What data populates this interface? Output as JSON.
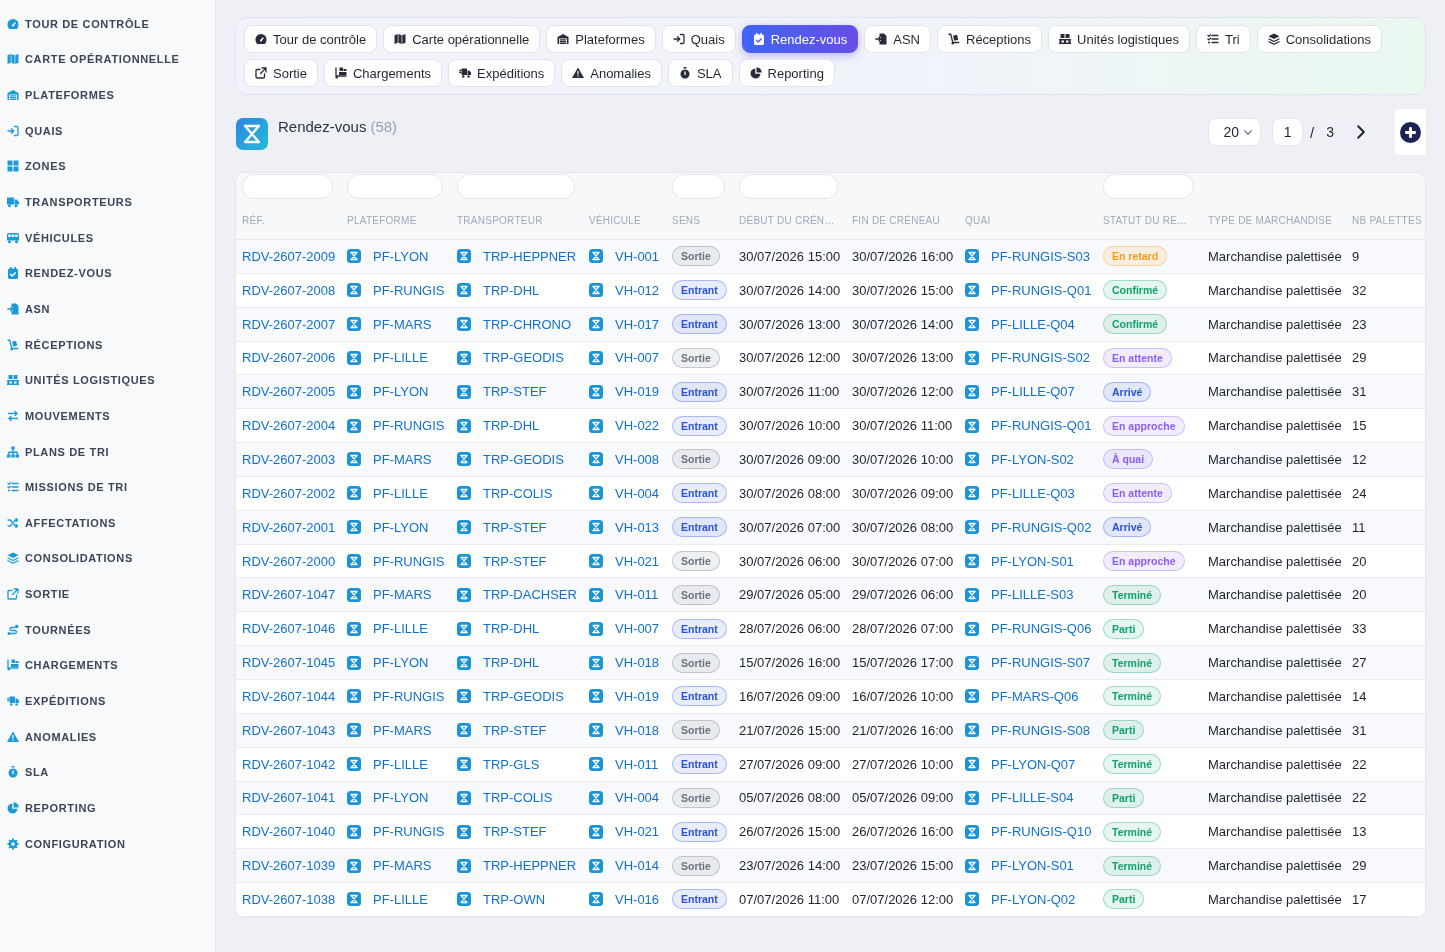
{
  "sidebar": {
    "items": [
      {
        "label": "TOUR DE CONTRÔLE"
      },
      {
        "label": "CARTE OPÉRATIONNELLE"
      },
      {
        "label": "PLATEFORMES"
      },
      {
        "label": "QUAIS"
      },
      {
        "label": "ZONES"
      },
      {
        "label": "TRANSPORTEURS"
      },
      {
        "label": "VÉHICULES"
      },
      {
        "label": "RENDEZ-VOUS"
      },
      {
        "label": "ASN"
      },
      {
        "label": "RÉCEPTIONS"
      },
      {
        "label": "UNITÉS LOGISTIQUES"
      },
      {
        "label": "MOUVEMENTS"
      },
      {
        "label": "PLANS DE TRI"
      },
      {
        "label": "MISSIONS DE TRI"
      },
      {
        "label": "AFFECTATIONS"
      },
      {
        "label": "CONSOLIDATIONS"
      },
      {
        "label": "SORTIE"
      },
      {
        "label": "TOURNÉES"
      },
      {
        "label": "CHARGEMENTS"
      },
      {
        "label": "EXPÉDITIONS"
      },
      {
        "label": "ANOMALIES"
      },
      {
        "label": "SLA"
      },
      {
        "label": "REPORTING"
      },
      {
        "label": "CONFIGURATION"
      }
    ]
  },
  "tabs": [
    {
      "label": "Tour de contrôle",
      "selected": false
    },
    {
      "label": "Carte opérationnelle",
      "selected": false
    },
    {
      "label": "Plateformes",
      "selected": false
    },
    {
      "label": "Quais",
      "selected": false
    },
    {
      "label": "Rendez-vous",
      "selected": true
    },
    {
      "label": "ASN",
      "selected": false
    },
    {
      "label": "Réceptions",
      "selected": false
    },
    {
      "label": "Unités logistiques",
      "selected": false
    },
    {
      "label": "Tri",
      "selected": false
    },
    {
      "label": "Consolidations",
      "selected": false
    },
    {
      "label": "Sortie",
      "selected": false
    },
    {
      "label": "Chargements",
      "selected": false
    },
    {
      "label": "Expéditions",
      "selected": false
    },
    {
      "label": "Anomalies",
      "selected": false
    },
    {
      "label": "SLA",
      "selected": false
    },
    {
      "label": "Reporting",
      "selected": false
    }
  ],
  "header": {
    "title": "Rendez-vous",
    "count": "(58)",
    "page_size": "20",
    "page": "1",
    "separator": "/",
    "total_pages": "3"
  },
  "table": {
    "columns": [
      {
        "label": "RÉF.",
        "filter": true
      },
      {
        "label": "PLATEFORME",
        "filter": true
      },
      {
        "label": "TRANSPORTEUR",
        "filter": true
      },
      {
        "label": "VÉHICULE",
        "filter": false
      },
      {
        "label": "SENS",
        "filter": true
      },
      {
        "label": "DÉBUT DU CRÉN…",
        "filter": true
      },
      {
        "label": "FIN DE CRÉNEAU",
        "filter": false
      },
      {
        "label": "QUAI",
        "filter": false
      },
      {
        "label": "STATUT DU RE…",
        "filter": true
      },
      {
        "label": "TYPE DE MARCHANDISE",
        "filter": false
      },
      {
        "label": "NB PALETTES",
        "filter": false
      }
    ],
    "rows": [
      {
        "ref": "RDV-2607-2009",
        "platform": "PF-LYON",
        "carrier": "TRP-HEPPNER",
        "vehicle": "VH-001",
        "direction": {
          "label": "Sortie",
          "color": "#6b7280"
        },
        "start": "30/07/2026 15:00",
        "end": "30/07/2026 16:00",
        "dock": "PF-RUNGIS-S03",
        "status": {
          "label": "En retard",
          "color": "#f59e0b"
        },
        "goods": "Marchandise palettisée",
        "pallets": "9"
      },
      {
        "ref": "RDV-2607-2008",
        "platform": "PF-RUNGIS",
        "carrier": "TRP-DHL",
        "vehicle": "VH-012",
        "direction": {
          "label": "Entrant",
          "color": "#2952d9"
        },
        "start": "30/07/2026 14:00",
        "end": "30/07/2026 15:00",
        "dock": "PF-RUNGIS-Q01",
        "status": {
          "label": "Confirmé",
          "color": "#12a36c"
        },
        "goods": "Marchandise palettisée",
        "pallets": "32"
      },
      {
        "ref": "RDV-2607-2007",
        "platform": "PF-MARS",
        "carrier": "TRP-CHRONO",
        "vehicle": "VH-017",
        "direction": {
          "label": "Entrant",
          "color": "#2952d9"
        },
        "start": "30/07/2026 13:00",
        "end": "30/07/2026 14:00",
        "dock": "PF-LILLE-Q04",
        "status": {
          "label": "Confirmé",
          "color": "#12a36c"
        },
        "goods": "Marchandise palettisée",
        "pallets": "23"
      },
      {
        "ref": "RDV-2607-2006",
        "platform": "PF-LILLE",
        "carrier": "TRP-GEODIS",
        "vehicle": "VH-007",
        "direction": {
          "label": "Sortie",
          "color": "#6b7280"
        },
        "start": "30/07/2026 12:00",
        "end": "30/07/2026 13:00",
        "dock": "PF-RUNGIS-S02",
        "status": {
          "label": "En attente",
          "color": "#8b5cf6"
        },
        "goods": "Marchandise palettisée",
        "pallets": "29"
      },
      {
        "ref": "RDV-2607-2005",
        "platform": "PF-LYON",
        "carrier": "TRP-STEF",
        "vehicle": "VH-019",
        "direction": {
          "label": "Entrant",
          "color": "#2952d9"
        },
        "start": "30/07/2026 11:00",
        "end": "30/07/2026 12:00",
        "dock": "PF-LILLE-Q07",
        "status": {
          "label": "Arrivé",
          "color": "#2952d9"
        },
        "goods": "Marchandise palettisée",
        "pallets": "31"
      },
      {
        "ref": "RDV-2607-2004",
        "platform": "PF-RUNGIS",
        "carrier": "TRP-DHL",
        "vehicle": "VH-022",
        "direction": {
          "label": "Entrant",
          "color": "#2952d9"
        },
        "start": "30/07/2026 10:00",
        "end": "30/07/2026 11:00",
        "dock": "PF-RUNGIS-Q01",
        "status": {
          "label": "En approche",
          "color": "#8b5cf6"
        },
        "goods": "Marchandise palettisée",
        "pallets": "15"
      },
      {
        "ref": "RDV-2607-2003",
        "platform": "PF-MARS",
        "carrier": "TRP-GEODIS",
        "vehicle": "VH-008",
        "direction": {
          "label": "Sortie",
          "color": "#6b7280"
        },
        "start": "30/07/2026 09:00",
        "end": "30/07/2026 10:00",
        "dock": "PF-LYON-S02",
        "status": {
          "label": "À quai",
          "color": "#8b5cf6"
        },
        "goods": "Marchandise palettisée",
        "pallets": "12"
      },
      {
        "ref": "RDV-2607-2002",
        "platform": "PF-LILLE",
        "carrier": "TRP-COLIS",
        "vehicle": "VH-004",
        "direction": {
          "label": "Entrant",
          "color": "#2952d9"
        },
        "start": "30/07/2026 08:00",
        "end": "30/07/2026 09:00",
        "dock": "PF-LILLE-Q03",
        "status": {
          "label": "En attente",
          "color": "#8b5cf6"
        },
        "goods": "Marchandise palettisée",
        "pallets": "24"
      },
      {
        "ref": "RDV-2607-2001",
        "platform": "PF-LYON",
        "carrier": "TRP-STEF",
        "vehicle": "VH-013",
        "direction": {
          "label": "Entrant",
          "color": "#2952d9"
        },
        "start": "30/07/2026 07:00",
        "end": "30/07/2026 08:00",
        "dock": "PF-RUNGIS-Q02",
        "status": {
          "label": "Arrivé",
          "color": "#2952d9"
        },
        "goods": "Marchandise palettisée",
        "pallets": "11"
      },
      {
        "ref": "RDV-2607-2000",
        "platform": "PF-RUNGIS",
        "carrier": "TRP-STEF",
        "vehicle": "VH-021",
        "direction": {
          "label": "Sortie",
          "color": "#6b7280"
        },
        "start": "30/07/2026 06:00",
        "end": "30/07/2026 07:00",
        "dock": "PF-LYON-S01",
        "status": {
          "label": "En approche",
          "color": "#8b5cf6"
        },
        "goods": "Marchandise palettisée",
        "pallets": "20"
      },
      {
        "ref": "RDV-2607-1047",
        "platform": "PF-MARS",
        "carrier": "TRP-DACHSER",
        "vehicle": "VH-011",
        "direction": {
          "label": "Sortie",
          "color": "#6b7280"
        },
        "start": "29/07/2026 05:00",
        "end": "29/07/2026 06:00",
        "dock": "PF-LILLE-S03",
        "status": {
          "label": "Terminé",
          "color": "#12a36c"
        },
        "goods": "Marchandise palettisée",
        "pallets": "20"
      },
      {
        "ref": "RDV-2607-1046",
        "platform": "PF-LILLE",
        "carrier": "TRP-DHL",
        "vehicle": "VH-007",
        "direction": {
          "label": "Entrant",
          "color": "#2952d9"
        },
        "start": "28/07/2026 06:00",
        "end": "28/07/2026 07:00",
        "dock": "PF-RUNGIS-Q06",
        "status": {
          "label": "Parti",
          "color": "#12a36c"
        },
        "goods": "Marchandise palettisée",
        "pallets": "33"
      },
      {
        "ref": "RDV-2607-1045",
        "platform": "PF-LYON",
        "carrier": "TRP-DHL",
        "vehicle": "VH-018",
        "direction": {
          "label": "Sortie",
          "color": "#6b7280"
        },
        "start": "15/07/2026 16:00",
        "end": "15/07/2026 17:00",
        "dock": "PF-RUNGIS-S07",
        "status": {
          "label": "Terminé",
          "color": "#12a36c"
        },
        "goods": "Marchandise palettisée",
        "pallets": "27"
      },
      {
        "ref": "RDV-2607-1044",
        "platform": "PF-RUNGIS",
        "carrier": "TRP-GEODIS",
        "vehicle": "VH-019",
        "direction": {
          "label": "Entrant",
          "color": "#2952d9"
        },
        "start": "16/07/2026 09:00",
        "end": "16/07/2026 10:00",
        "dock": "PF-MARS-Q06",
        "status": {
          "label": "Terminé",
          "color": "#12a36c"
        },
        "goods": "Marchandise palettisée",
        "pallets": "14"
      },
      {
        "ref": "RDV-2607-1043",
        "platform": "PF-MARS",
        "carrier": "TRP-STEF",
        "vehicle": "VH-018",
        "direction": {
          "label": "Sortie",
          "color": "#6b7280"
        },
        "start": "21/07/2026 15:00",
        "end": "21/07/2026 16:00",
        "dock": "PF-RUNGIS-S08",
        "status": {
          "label": "Parti",
          "color": "#12a36c"
        },
        "goods": "Marchandise palettisée",
        "pallets": "31"
      },
      {
        "ref": "RDV-2607-1042",
        "platform": "PF-LILLE",
        "carrier": "TRP-GLS",
        "vehicle": "VH-011",
        "direction": {
          "label": "Entrant",
          "color": "#2952d9"
        },
        "start": "27/07/2026 09:00",
        "end": "27/07/2026 10:00",
        "dock": "PF-LYON-Q07",
        "status": {
          "label": "Terminé",
          "color": "#12a36c"
        },
        "goods": "Marchandise palettisée",
        "pallets": "22"
      },
      {
        "ref": "RDV-2607-1041",
        "platform": "PF-LYON",
        "carrier": "TRP-COLIS",
        "vehicle": "VH-004",
        "direction": {
          "label": "Sortie",
          "color": "#6b7280"
        },
        "start": "05/07/2026 08:00",
        "end": "05/07/2026 09:00",
        "dock": "PF-LILLE-S04",
        "status": {
          "label": "Parti",
          "color": "#12a36c"
        },
        "goods": "Marchandise palettisée",
        "pallets": "22"
      },
      {
        "ref": "RDV-2607-1040",
        "platform": "PF-RUNGIS",
        "carrier": "TRP-STEF",
        "vehicle": "VH-021",
        "direction": {
          "label": "Entrant",
          "color": "#2952d9"
        },
        "start": "26/07/2026 15:00",
        "end": "26/07/2026 16:00",
        "dock": "PF-RUNGIS-Q10",
        "status": {
          "label": "Terminé",
          "color": "#12a36c"
        },
        "goods": "Marchandise palettisée",
        "pallets": "13"
      },
      {
        "ref": "RDV-2607-1039",
        "platform": "PF-MARS",
        "carrier": "TRP-HEPPNER",
        "vehicle": "VH-014",
        "direction": {
          "label": "Sortie",
          "color": "#6b7280"
        },
        "start": "23/07/2026 14:00",
        "end": "23/07/2026 15:00",
        "dock": "PF-LYON-S01",
        "status": {
          "label": "Terminé",
          "color": "#12a36c"
        },
        "goods": "Marchandise palettisée",
        "pallets": "29"
      },
      {
        "ref": "RDV-2607-1038",
        "platform": "PF-LILLE",
        "carrier": "TRP-OWN",
        "vehicle": "VH-016",
        "direction": {
          "label": "Entrant",
          "color": "#2952d9"
        },
        "start": "07/07/2026 11:00",
        "end": "07/07/2026 12:00",
        "dock": "PF-LYON-Q02",
        "status": {
          "label": "Parti",
          "color": "#12a36c"
        },
        "goods": "Marchandise palettisée",
        "pallets": "17"
      }
    ]
  }
}
